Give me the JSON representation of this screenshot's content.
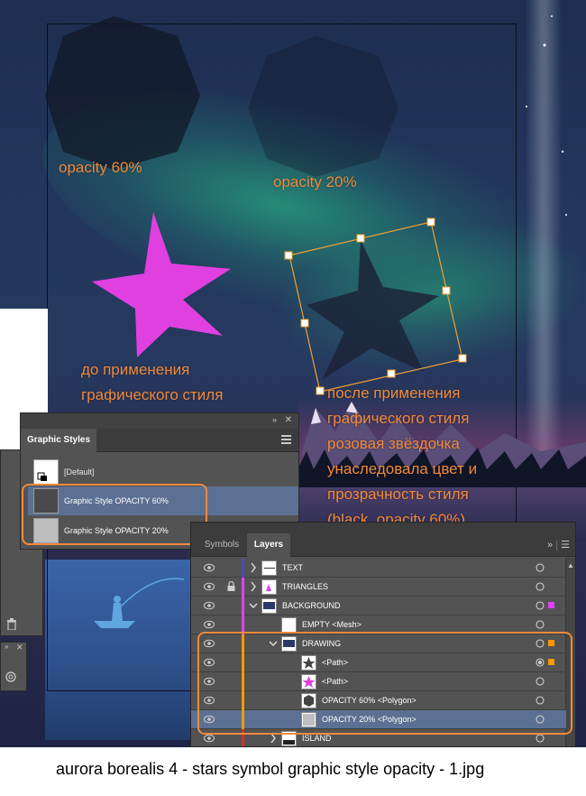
{
  "annotations": {
    "opacity_60": "opacity 60%",
    "opacity_20": "opacity 20%",
    "before_line1": "до применения",
    "before_line2": "графического стиля",
    "after_line1": "после применения",
    "after_line2": "графического стиля",
    "after_line3": "розовая звёздочка",
    "after_line4": "унаследовала цвет и",
    "after_line5": "прозрачность стиля",
    "after_line6": "(black, opacity 60%)"
  },
  "graphic_styles_panel": {
    "tab_label": "Graphic Styles",
    "items": [
      {
        "label": "[Default]",
        "selected": false
      },
      {
        "label": "Graphic Style OPACITY 60%",
        "selected": true
      },
      {
        "label": "Graphic Style OPACITY 20%",
        "selected": false
      }
    ]
  },
  "layers_panel": {
    "tabs": [
      "Symbols",
      "Layers"
    ],
    "active_tab": "Layers",
    "rows": [
      {
        "name": "TEXT",
        "bar_color": "#3f51b5",
        "locked": false,
        "expanded": false,
        "selected": false,
        "color_square": ""
      },
      {
        "name": "TRIANGLES",
        "bar_color": "#e040fb",
        "locked": true,
        "expanded": false,
        "selected": false,
        "color_square": ""
      },
      {
        "name": "BACKGROUND",
        "bar_color": "#e040fb",
        "locked": false,
        "expanded": true,
        "selected": false,
        "color_square": "#e040fb"
      },
      {
        "name": "EMPTY <Mesh>",
        "bar_color": "#e040fb",
        "locked": false,
        "expanded": false,
        "selected": false,
        "color_square": ""
      },
      {
        "name": "DRAWING",
        "bar_color": "#ff9800",
        "locked": false,
        "expanded": true,
        "selected": false,
        "color_square": "#ff9800"
      },
      {
        "name": "<Path>",
        "bar_color": "#ff9800",
        "locked": false,
        "expanded": false,
        "selected": false,
        "color_square": "#ff9800"
      },
      {
        "name": "<Path>",
        "bar_color": "#ff9800",
        "locked": false,
        "expanded": false,
        "selected": false,
        "color_square": ""
      },
      {
        "name": "OPACITY 60% <Polygon>",
        "bar_color": "#ff9800",
        "locked": false,
        "expanded": false,
        "selected": false,
        "color_square": ""
      },
      {
        "name": "OPACITY 20% <Polygon>",
        "bar_color": "#ff9800",
        "locked": false,
        "expanded": false,
        "selected": true,
        "color_square": ""
      },
      {
        "name": "ISLAND",
        "bar_color": "#d32f2f",
        "locked": false,
        "expanded": false,
        "selected": false,
        "color_square": ""
      }
    ]
  },
  "caption": "aurora borealis 4 - stars symbol graphic style opacity - 1.jpg",
  "colors": {
    "annotation": "#f08a3c",
    "pink_star": "#e040e0",
    "dark_star": "#1c2338",
    "selection": "#5b7092",
    "bounding_box": "#f0a030"
  }
}
